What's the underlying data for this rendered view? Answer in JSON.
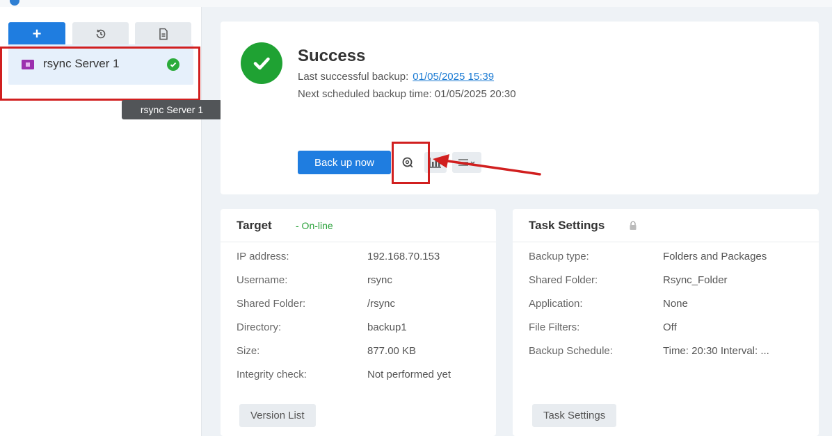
{
  "sidebar": {
    "toolbar": {
      "add_label": "+"
    },
    "tasks": [
      {
        "name": "rsync Server 1"
      }
    ],
    "tooltip": "rsync Server 1"
  },
  "status": {
    "title": "Success",
    "last_backup_label": "Last successful backup:",
    "last_backup_value": "01/05/2025 15:39",
    "next_backup_label": "Next scheduled backup time:",
    "next_backup_value": "01/05/2025 20:30",
    "backup_now_label": "Back up now"
  },
  "target": {
    "title": "Target",
    "status": "- On-line",
    "rows": [
      {
        "label": "IP address:",
        "value": "192.168.70.153"
      },
      {
        "label": "Username:",
        "value": "rsync"
      },
      {
        "label": "Shared Folder:",
        "value": "/rsync"
      },
      {
        "label": "Directory:",
        "value": "backup1"
      },
      {
        "label": "Size:",
        "value": "877.00 KB"
      },
      {
        "label": "Integrity check:",
        "value": "Not performed yet"
      }
    ],
    "button_label": "Version List"
  },
  "task_settings": {
    "title": "Task Settings",
    "rows": [
      {
        "label": "Backup type:",
        "value": "Folders and Packages"
      },
      {
        "label": "Shared Folder:",
        "value": "Rsync_Folder"
      },
      {
        "label": "Application:",
        "value": "None"
      },
      {
        "label": "File Filters:",
        "value": "Off"
      },
      {
        "label": "Backup Schedule:",
        "value": "Time: 20:30 Interval: ..."
      }
    ],
    "button_label": "Task Settings"
  },
  "colors": {
    "primary": "#1f7de0",
    "success": "#1fa233",
    "highlight": "#d11f1f",
    "online": "#2aa13a"
  },
  "icons": {
    "add": "plus-icon",
    "restore": "history-icon",
    "log": "document-icon",
    "task": "folder-icon",
    "task_status": "check-circle-icon",
    "success": "check-circle-icon",
    "browse": "search-icon",
    "statistics": "bar-chart-icon",
    "more": "menu-icon",
    "settings_lock": "lock-icon"
  }
}
